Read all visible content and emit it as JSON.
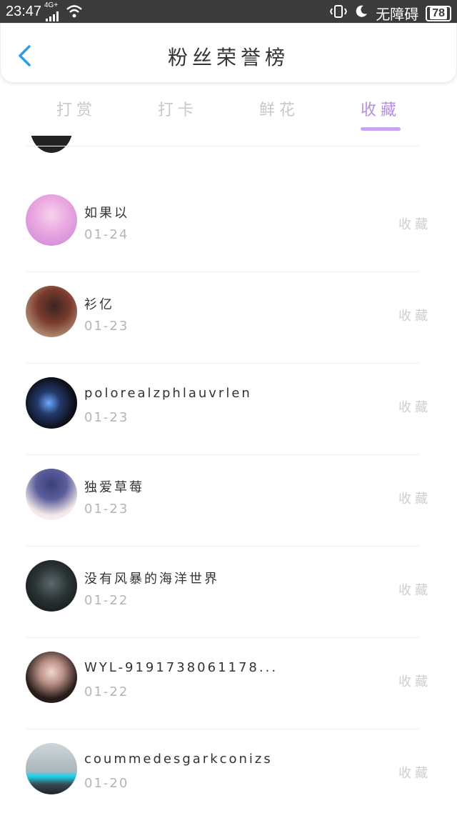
{
  "status_bar": {
    "time": "23:47",
    "network": "4G+",
    "right_label": "无障碍",
    "battery": "78"
  },
  "header": {
    "title": "粉丝荣誉榜",
    "back_icon": "chevron-left-icon"
  },
  "tabs": [
    {
      "label": "打赏",
      "active": false
    },
    {
      "label": "打卡",
      "active": false
    },
    {
      "label": "鲜花",
      "active": false
    },
    {
      "label": "收藏",
      "active": true
    }
  ],
  "colors": {
    "accent": "#b58fe0",
    "underline": "#c6a6f0",
    "back": "#2f9ae8"
  },
  "fans": [
    {
      "name": "如果以",
      "date": "01-24",
      "action": "收藏"
    },
    {
      "name": "衫亿",
      "date": "01-23",
      "action": "收藏"
    },
    {
      "name": "polorealzphlauvrlen",
      "date": "01-23",
      "action": "收藏"
    },
    {
      "name": "独爱草莓",
      "date": "01-23",
      "action": "收藏"
    },
    {
      "name": "没有风暴的海洋世界",
      "date": "01-22",
      "action": "收藏"
    },
    {
      "name": "WYL-9191738061178...",
      "date": "01-22",
      "action": "收藏"
    },
    {
      "name": "coummedesgarkconizs",
      "date": "01-20",
      "action": "收藏"
    }
  ]
}
